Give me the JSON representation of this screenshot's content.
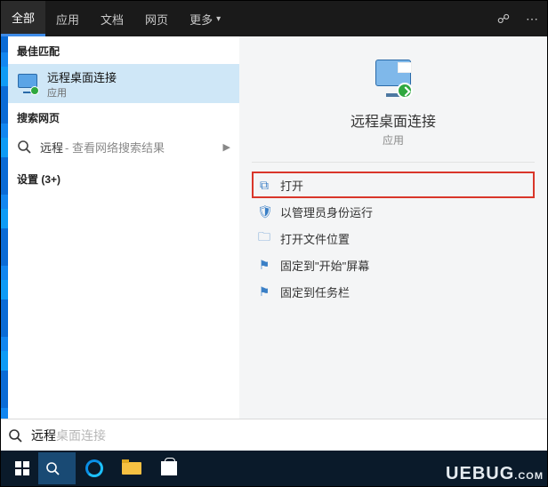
{
  "tabs": {
    "all": "全部",
    "apps": "应用",
    "docs": "文档",
    "web": "网页",
    "more": "更多"
  },
  "sections": {
    "best_match": "最佳匹配",
    "search_web": "搜索网页",
    "settings": "设置 (3+)"
  },
  "best_match_item": {
    "title": "远程桌面连接",
    "subtitle": "应用"
  },
  "web_item": {
    "term": "远程",
    "hint": " - 查看网络搜索结果"
  },
  "detail": {
    "title": "远程桌面连接",
    "subtitle": "应用"
  },
  "actions": {
    "open": "打开",
    "run_admin": "以管理员身份运行",
    "open_location": "打开文件位置",
    "pin_start": "固定到\"开始\"屏幕",
    "pin_taskbar": "固定到任务栏"
  },
  "searchbox": {
    "typed": "远程",
    "suggestion": "桌面连接"
  },
  "watermark": {
    "brand": "UEBUG",
    "dom": ".COM"
  }
}
